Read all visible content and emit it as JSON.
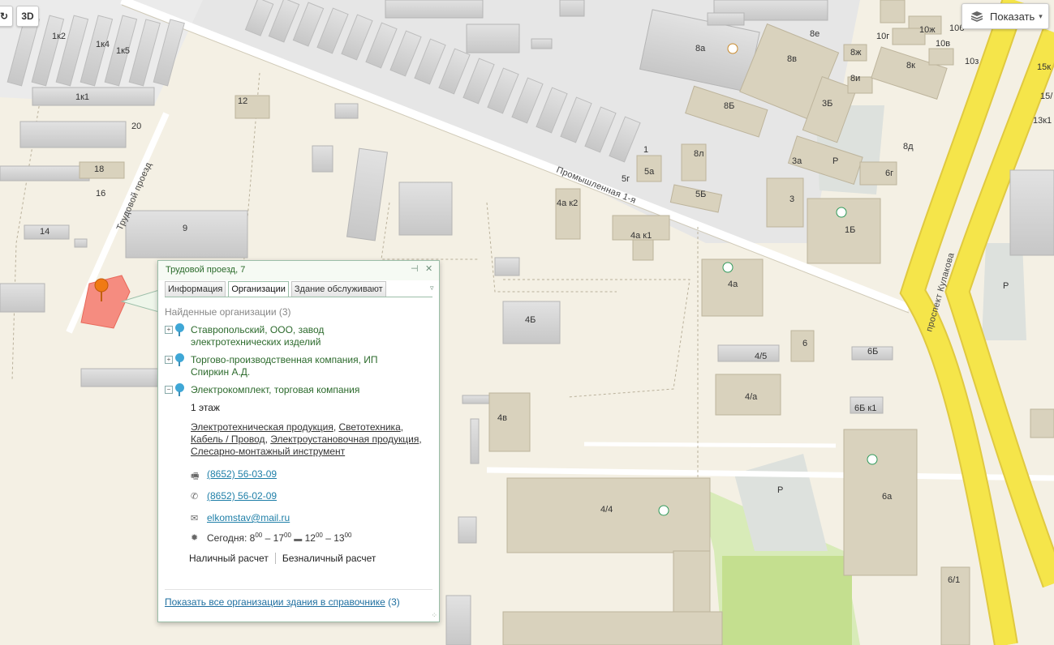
{
  "controls": {
    "three_d": "3D"
  },
  "layers": {
    "label": "Показать",
    "caret": "▾"
  },
  "streets": {
    "industrial": "Промышленная 1-я",
    "trudovoy": "Трудовой проезд",
    "kulakova": "проспект Кулакова"
  },
  "buildings": [
    "1к2",
    "1к4",
    "1к5",
    "1к1",
    "20",
    "18",
    "16",
    "14",
    "12",
    "9",
    "8а",
    "8е",
    "8в",
    "8ж",
    "8и",
    "8к",
    "10ж",
    "10в",
    "10г",
    "10з",
    "10б",
    "15к",
    "15/",
    "13к1",
    "8Б",
    "8л",
    "5Б",
    "5а",
    "5г",
    "1",
    "3Б",
    "3а",
    "3",
    "6г",
    "8д",
    "1Б",
    "4а к2",
    "4а к1",
    "4а",
    "4Б",
    "4/5",
    "6",
    "6Б",
    "4/а",
    "6Б к1",
    "4в",
    "4/4",
    "6а",
    "6/1"
  ],
  "parking_label": "Р",
  "balloon": {
    "title": "Трудовой проезд, 7",
    "pin_icon": "⊣",
    "close_icon": "✕",
    "tabs": [
      "Информация",
      "Организации",
      "Здание обслуживают"
    ],
    "tabs_dropdown": "▿",
    "found_header": "Найденные организации (3)",
    "orgs": [
      {
        "toggle": "+",
        "name": "Ставропольский, ООО, завод электротехнических изделий"
      },
      {
        "toggle": "+",
        "name": "Торгово-производственная компания, ИП Спиркин А.Д."
      },
      {
        "toggle": "−",
        "name": "Электрокомплект, торговая компания"
      }
    ],
    "floor": "1 этаж",
    "categories": [
      "Электротехническая продукция",
      "Светотехника",
      "Кабель / Провод",
      "Электроустановочная продукция",
      "Слесарно-монтажный инструмент"
    ],
    "fax": "(8652) 56-03-09",
    "phone": "(8652) 56-02-09",
    "email": "elkomstav@mail.ru",
    "hours": {
      "today_label": "Сегодня:",
      "open_h": "8",
      "open_m": "00",
      "close_h": "17",
      "close_m": "00",
      "break_from_h": "12",
      "break_from_m": "00",
      "break_to_h": "13",
      "break_to_m": "00",
      "dash": "–"
    },
    "payments": [
      "Наличный расчет",
      "Безналичный расчет"
    ],
    "show_all_text": "Показать все организации здания в справочнике",
    "show_all_count": "(3)",
    "resize_grip": "⁘"
  },
  "colors": {
    "background": "#f4f0e4",
    "industrial_zone": "#e4e4e4",
    "building_gray": "#d4d4d4",
    "building_beige": "#d9d2bd",
    "highway": "#f5e54a",
    "park": "#c8e29a",
    "selected_building": "#f58c80",
    "marker": "#f07a14"
  }
}
